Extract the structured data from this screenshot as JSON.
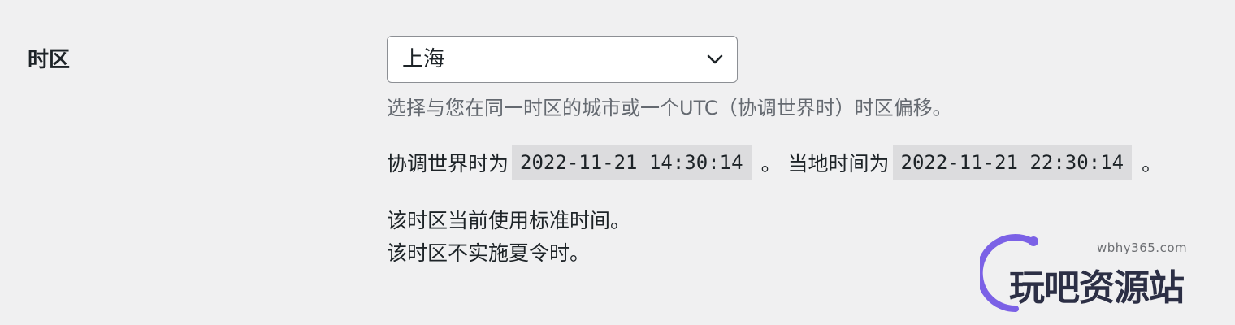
{
  "timezone": {
    "label": "时区",
    "selected": "上海",
    "description": "选择与您在同一时区的城市或一个UTC（协调世界时）时区偏移。",
    "utc_prefix": "协调世界时为",
    "utc_time": "2022-11-21 14:30:14",
    "mid_text": "。 当地时间为",
    "local_time": "2022-11-21 22:30:14",
    "end_text": "。",
    "info_line_1": "该时区当前使用标准时间。",
    "info_line_2": "该时区不实施夏令时。"
  },
  "watermark": {
    "domain": "wbhy365.com",
    "text": "玩吧资源站"
  },
  "icons": {
    "select_chevron": "chevron-down-icon"
  },
  "colors": {
    "background": "#f0f0f1",
    "text": "#1d2327",
    "description": "#646970",
    "code_background": "#dcdcde",
    "select_border": "#8c8f94",
    "watermark_arc": "#7b61e6"
  }
}
